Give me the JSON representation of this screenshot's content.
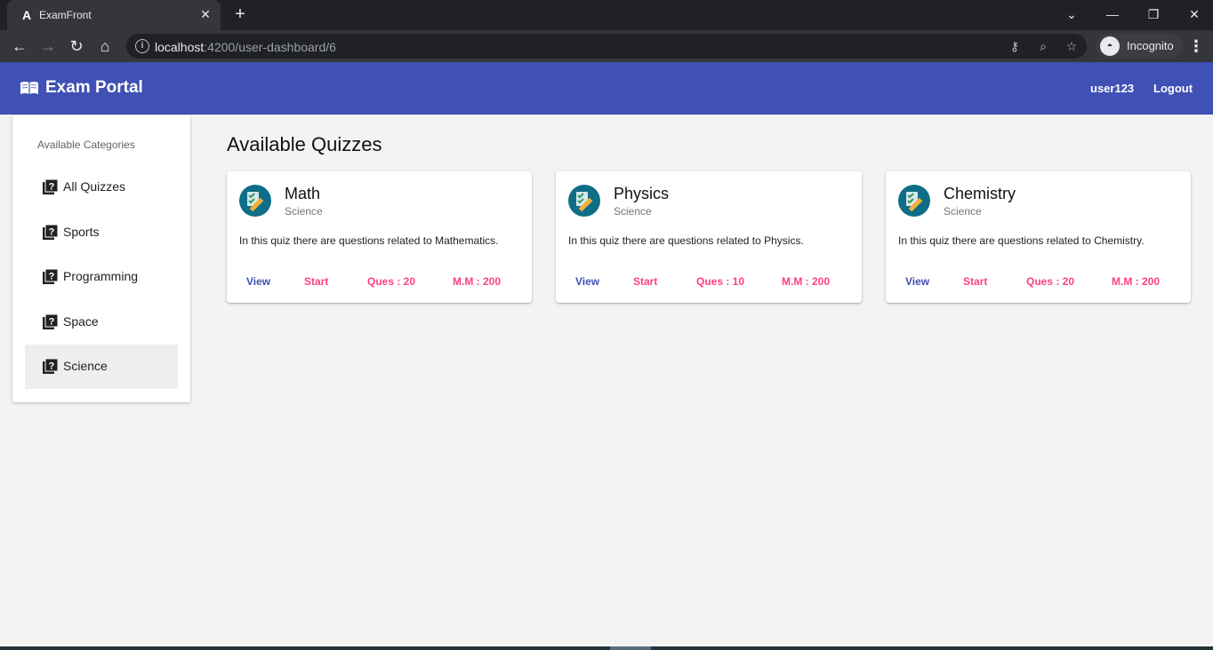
{
  "browser": {
    "tab_title": "ExamFront",
    "favicon_glyph": "A",
    "url_host": "localhost",
    "url_path": ":4200/user-dashboard/6",
    "profile_label": "Incognito"
  },
  "header": {
    "brand": "Exam Portal",
    "username": "user123",
    "logout": "Logout",
    "color": "#3f51b5"
  },
  "sidebar": {
    "heading": "Available Categories",
    "items": [
      {
        "label": "All Quizzes"
      },
      {
        "label": "Sports"
      },
      {
        "label": "Programming"
      },
      {
        "label": "Space"
      },
      {
        "label": "Science",
        "active": true
      }
    ]
  },
  "main": {
    "title": "Available Quizzes",
    "quizzes": [
      {
        "title": "Math",
        "category": "Science",
        "description": "In this quiz there are questions related to Mathematics.",
        "view": "View",
        "start": "Start",
        "questions": "Ques : 20",
        "max_marks": "M.M : 200"
      },
      {
        "title": "Physics",
        "category": "Science",
        "description": "In this quiz there are questions related to Physics.",
        "view": "View",
        "start": "Start",
        "questions": "Ques : 10",
        "max_marks": "M.M : 200"
      },
      {
        "title": "Chemistry",
        "category": "Science",
        "description": "In this quiz there are questions related to Chemistry.",
        "view": "View",
        "start": "Start",
        "questions": "Ques : 20",
        "max_marks": "M.M : 200"
      }
    ]
  },
  "colors": {
    "primary": "#3f51b5",
    "accent": "#ff4081"
  }
}
